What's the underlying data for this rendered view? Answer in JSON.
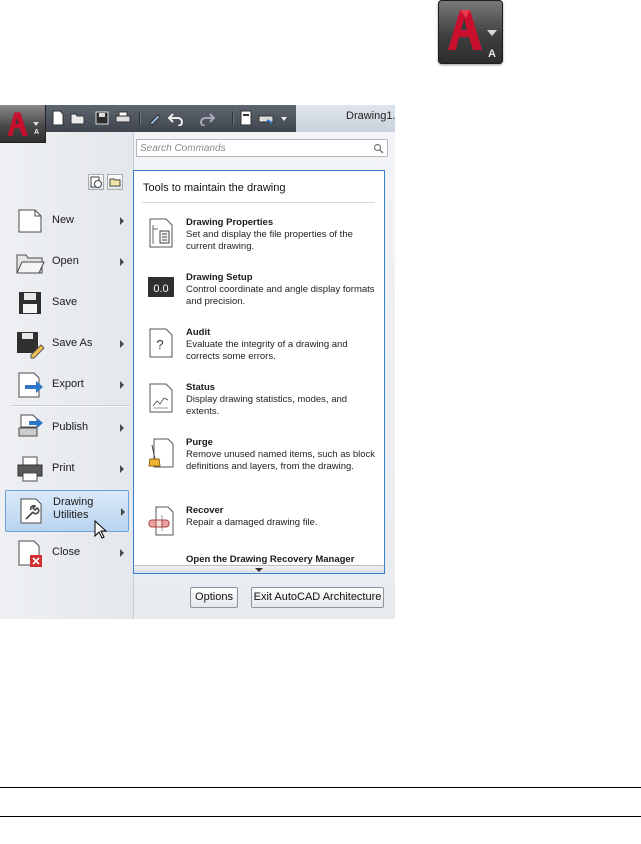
{
  "app_button": {
    "badge": "A"
  },
  "window": {
    "title": "Drawing1."
  },
  "search": {
    "placeholder": "Search Commands"
  },
  "menu": {
    "items": [
      {
        "label": "New"
      },
      {
        "label": "Open"
      },
      {
        "label": "Save"
      },
      {
        "label": "Save As"
      },
      {
        "label": "Export"
      },
      {
        "label": "Publish"
      },
      {
        "label": "Print"
      },
      {
        "label_line1": "Drawing",
        "label_line2": "Utilities"
      },
      {
        "label": "Close"
      }
    ]
  },
  "panel": {
    "title": "Tools to maintain the drawing",
    "entries": [
      {
        "title": "Drawing Properties",
        "description": "Set and display the file properties of the current drawing.",
        "icon": "drawing-properties-icon"
      },
      {
        "title": "Drawing Setup",
        "description": "Control coordinate and angle display formats and precision.",
        "icon": "drawing-setup-icon",
        "icon_text": "0.0"
      },
      {
        "title": "Audit",
        "description": "Evaluate the integrity of a drawing and corrects some errors.",
        "icon": "audit-icon",
        "icon_text": "?"
      },
      {
        "title": "Status",
        "description": "Display drawing statistics, modes, and extents.",
        "icon": "status-icon"
      },
      {
        "title": "Purge",
        "description": "Remove unused named items, such as block definitions and layers, from the drawing.",
        "icon": "purge-icon"
      },
      {
        "title": "Recover",
        "description": "Repair a damaged drawing file.",
        "icon": "recover-icon"
      }
    ],
    "last_entry": "Open the Drawing Recovery Manager"
  },
  "buttons": {
    "options": "Options",
    "exit": "Exit AutoCAD Architecture"
  },
  "colors": {
    "accent": "#3d7fcf",
    "highlight": "#b9d4f0",
    "logo_red": "#c8102e"
  }
}
